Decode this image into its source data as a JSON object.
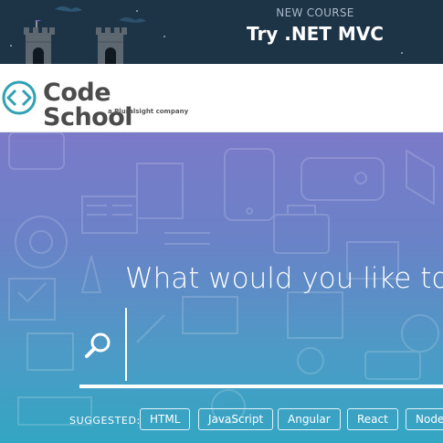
{
  "banner": {
    "eyebrow": "NEW COURSE",
    "title": "Try .NET MVC"
  },
  "header": {
    "logo_text": "Code School",
    "logo_tagline": "a Pluralsight company"
  },
  "hero": {
    "question": "What would you like to learn?",
    "search": {
      "value": "",
      "placeholder": ""
    },
    "suggested_label": "SUGGESTED:",
    "suggestions": [
      "HTML",
      "JavaScript",
      "Angular",
      "React",
      "Node"
    ]
  },
  "colors": {
    "banner_bg": "#1d3346",
    "brand_teal": "#2fa1b3",
    "hero_top": "#7b7ac9",
    "hero_bottom": "#33a6c3"
  },
  "icons": [
    "castle-icon",
    "code-school-logo-icon",
    "search-icon"
  ]
}
